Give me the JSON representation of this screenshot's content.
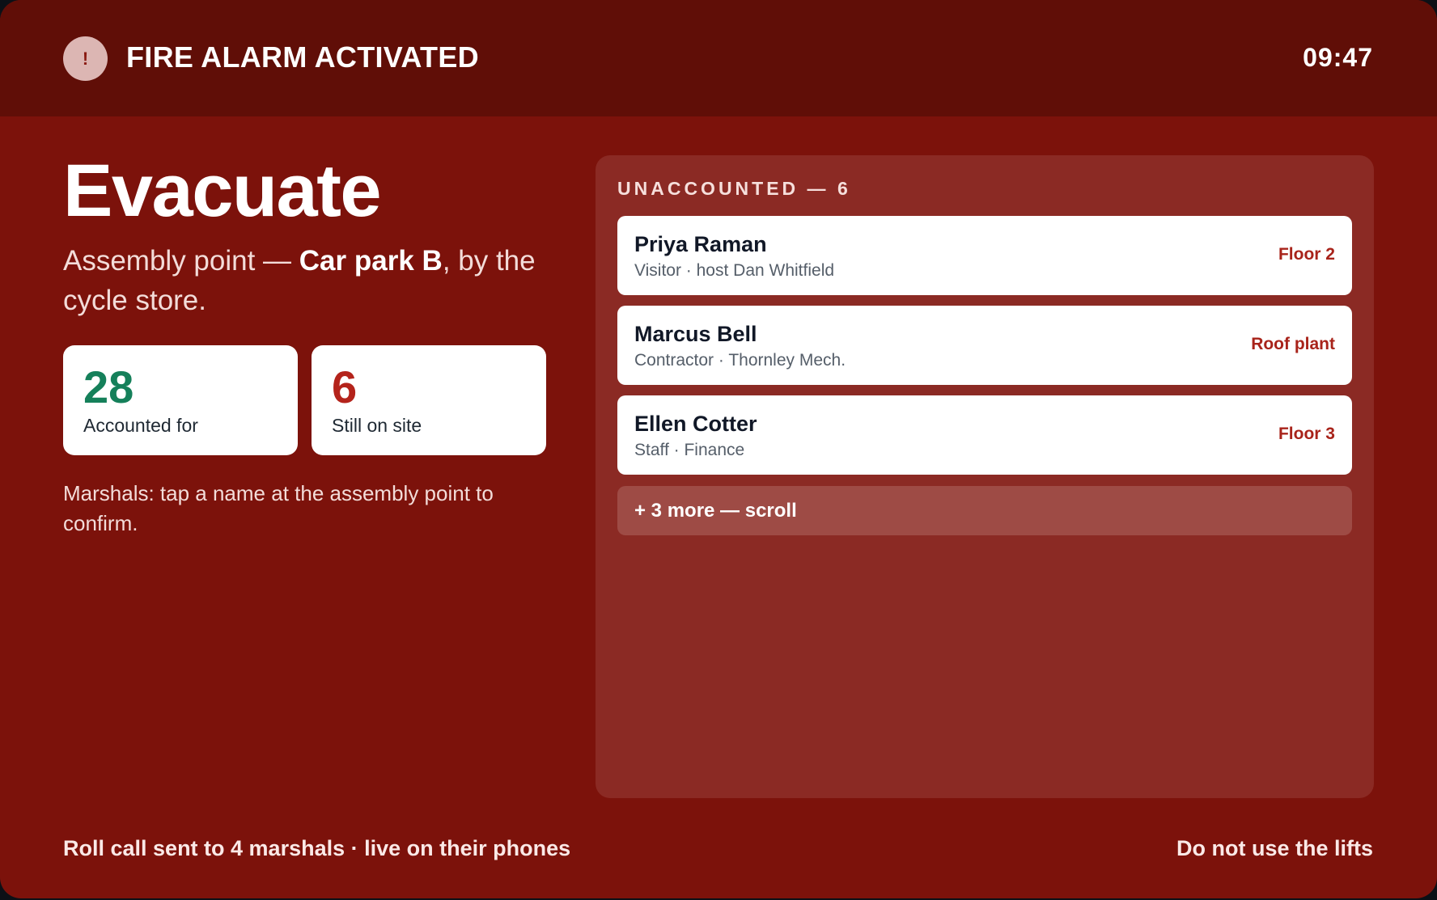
{
  "alarm": {
    "title": "FIRE ALARM ACTIVATED",
    "icon": "exclamation-icon",
    "icon_glyph": "!",
    "time": "09:47"
  },
  "main": {
    "headline": "Evacuate",
    "assembly_prefix": "Assembly point — ",
    "assembly_location": "Car park B",
    "assembly_suffix": ", by the cycle store."
  },
  "stats": {
    "accounted": {
      "value": "28",
      "label": "Accounted for",
      "color": "#15805a"
    },
    "on_site": {
      "value": "6",
      "label": "Still on site",
      "color": "#b4231b"
    }
  },
  "marshal_note": "Marshals: tap a name at the assembly point to confirm.",
  "unaccounted": {
    "heading": "UNACCOUNTED — 6",
    "people": [
      {
        "name": "Priya Raman",
        "meta": "Visitor · host Dan Whitfield",
        "location": "Floor 2"
      },
      {
        "name": "Marcus Bell",
        "meta": "Contractor · Thornley Mech.",
        "location": "Roof plant"
      },
      {
        "name": "Ellen Cotter",
        "meta": "Staff · Finance",
        "location": "Floor 3"
      }
    ],
    "more": "+ 3 more — scroll"
  },
  "footer": {
    "left": "Roll call sent to 4 marshals · live on their phones",
    "right": "Do not use the lifts"
  },
  "colors": {
    "background": "#7c120b",
    "alarm_bar": "#600e07",
    "panel": "#8b2a24",
    "location_accent": "#a8231a"
  }
}
